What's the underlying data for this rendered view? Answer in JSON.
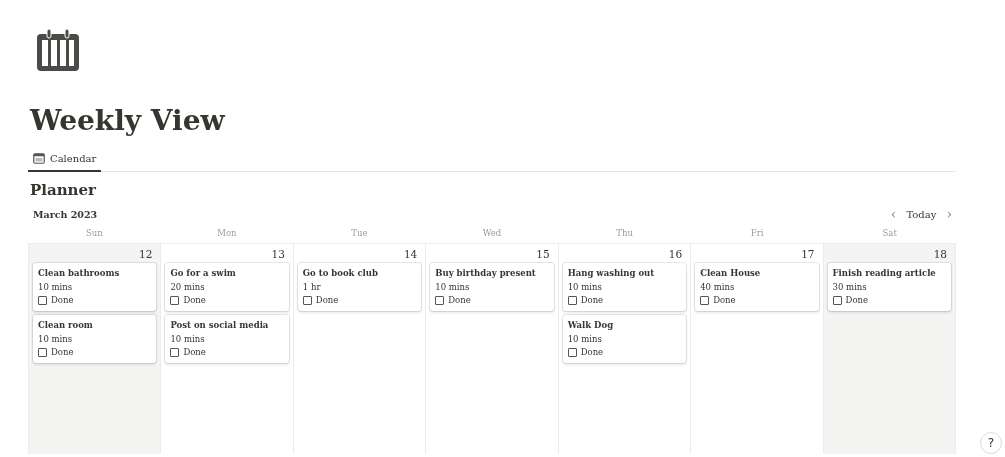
{
  "page": {
    "title": "Weekly View"
  },
  "views": [
    {
      "label": "Calendar",
      "selected": true
    }
  ],
  "calendar": {
    "title": "Planner",
    "month": "March 2023",
    "nav": {
      "prev": "‹",
      "today": "Today",
      "next": "›"
    },
    "days": [
      {
        "weekday": "Sun",
        "date": "12",
        "weekend": true,
        "events": [
          {
            "title": "Clean bathrooms",
            "duration": "10 mins",
            "checkbox_label": "Done",
            "checked": false
          },
          {
            "title": "Clean room",
            "duration": "10 mins",
            "checkbox_label": "Done",
            "checked": false
          }
        ]
      },
      {
        "weekday": "Mon",
        "date": "13",
        "weekend": false,
        "events": [
          {
            "title": "Go for a swim",
            "duration": "20 mins",
            "checkbox_label": "Done",
            "checked": false
          },
          {
            "title": "Post on social media",
            "duration": "10 mins",
            "checkbox_label": "Done",
            "checked": false
          }
        ]
      },
      {
        "weekday": "Tue",
        "date": "14",
        "weekend": false,
        "events": [
          {
            "title": "Go to book club",
            "duration": "1 hr",
            "checkbox_label": "Done",
            "checked": false
          }
        ]
      },
      {
        "weekday": "Wed",
        "date": "15",
        "weekend": false,
        "events": [
          {
            "title": "Buy birthday present",
            "duration": "10 mins",
            "checkbox_label": "Done",
            "checked": false
          }
        ]
      },
      {
        "weekday": "Thu",
        "date": "16",
        "weekend": false,
        "events": [
          {
            "title": "Hang washing out",
            "duration": "10 mins",
            "checkbox_label": "Done",
            "checked": false
          },
          {
            "title": "Walk Dog",
            "duration": "10 mins",
            "checkbox_label": "Done",
            "checked": false
          }
        ]
      },
      {
        "weekday": "Fri",
        "date": "17",
        "weekend": false,
        "events": [
          {
            "title": "Clean House",
            "duration": "40 mins",
            "checkbox_label": "Done",
            "checked": false
          }
        ]
      },
      {
        "weekday": "Sat",
        "date": "18",
        "weekend": true,
        "events": [
          {
            "title": "Finish reading article",
            "duration": "30 mins",
            "checkbox_label": "Done",
            "checked": false
          }
        ]
      }
    ]
  },
  "help_button": "?"
}
